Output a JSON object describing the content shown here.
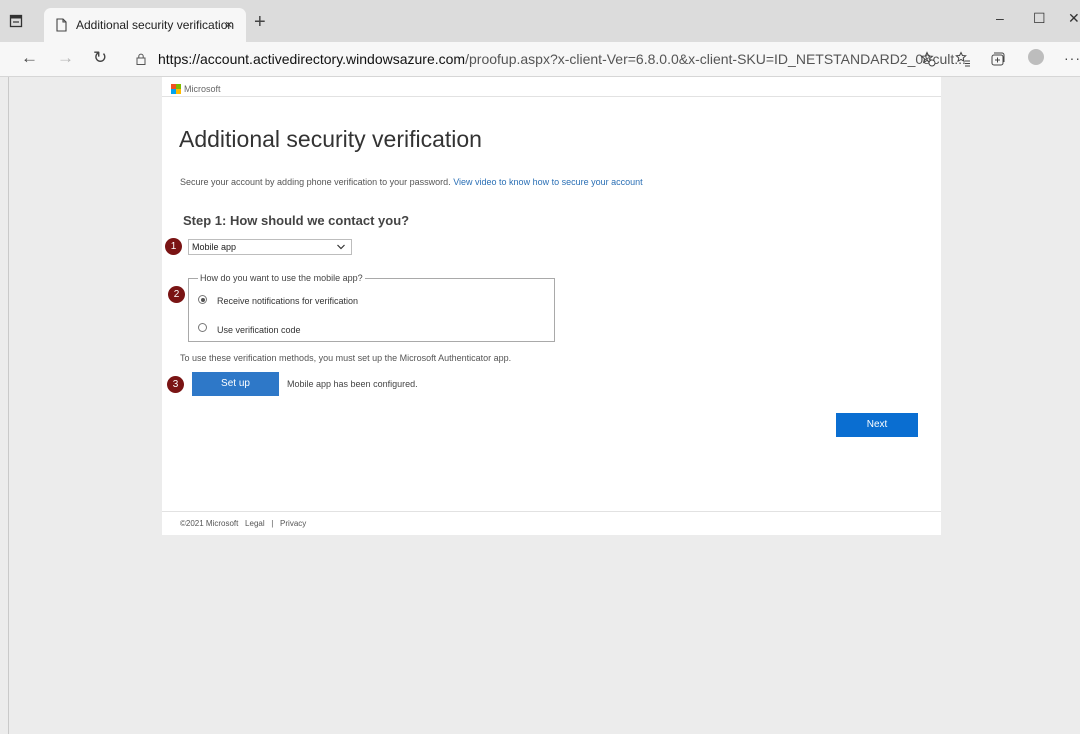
{
  "browser": {
    "tab_title": "Additional security verification",
    "tab_close": "×",
    "new_tab": "+",
    "url_domain": "https://account.activedirectory.windowsazure.com",
    "url_path": "/proofup.aspx?x-client-Ver=6.8.0.0&x-client-SKU=ID_NETSTANDARD2_0&cult...",
    "minimize": "–",
    "maximize": "☐",
    "close": "✕",
    "back": "←",
    "forward": "→",
    "refresh": "↻",
    "more": "···"
  },
  "page": {
    "brand": "Microsoft",
    "title": "Additional security verification",
    "intro_text": "Secure your account by adding phone verification to your password.",
    "intro_link": "View video to know how to secure your account",
    "step_title": "Step 1: How should we contact you?",
    "contact_method": "Mobile app",
    "mobile_app_legend": "How do you want to use the mobile app?",
    "options": [
      {
        "label": "Receive notifications for verification",
        "selected": true
      },
      {
        "label": "Use verification code",
        "selected": false
      }
    ],
    "note": "To use these verification methods, you must set up the Microsoft Authenticator app.",
    "setup_button": "Set up",
    "setup_status": "Mobile app has been configured.",
    "next_button": "Next",
    "badges": [
      "1",
      "2",
      "3"
    ],
    "footer": {
      "copyright": "©2021 Microsoft",
      "legal": "Legal",
      "separator": "|",
      "privacy": "Privacy"
    }
  },
  "colors": {
    "badge": "#7a1414",
    "setup_button": "#2e78c8",
    "next_button": "#0a6ed1",
    "link": "#2a6fb5",
    "logo": [
      "#f25022",
      "#7fba00",
      "#00a4ef",
      "#ffb900"
    ]
  }
}
